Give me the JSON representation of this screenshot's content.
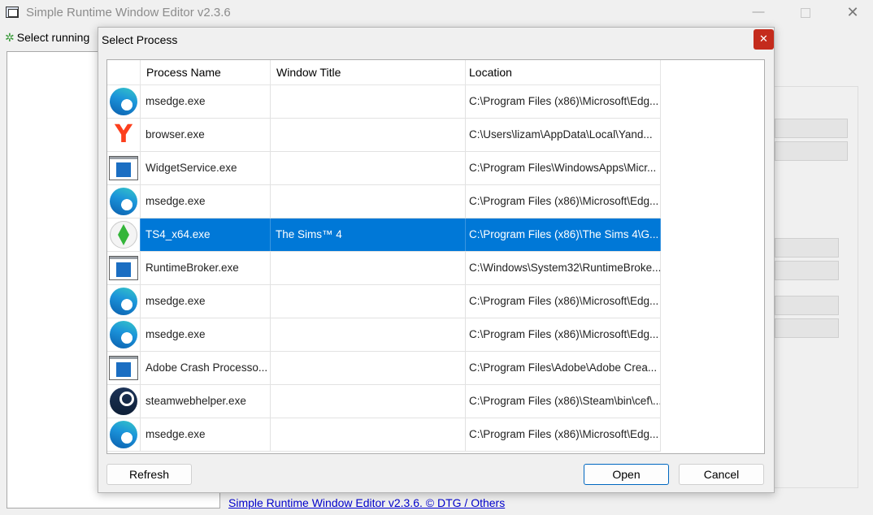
{
  "main_window": {
    "title": "Simple Runtime Window Editor v2.3.6",
    "controls": {
      "minimize": "—",
      "close": "✕"
    },
    "select_running_label": "Select running",
    "footer_link": "Simple Runtime Window Editor v2.3.6.  ©   DTG   / Others"
  },
  "dialog": {
    "title": "Select Process",
    "close_glyph": "✕",
    "columns": [
      "Process Name",
      "Window Title",
      "Location"
    ],
    "rows": [
      {
        "icon": "edge-icon",
        "name": "msedge.exe",
        "window_title": "",
        "location": "C:\\Program Files (x86)\\Microsoft\\Edg..."
      },
      {
        "icon": "yandex-icon",
        "name": "browser.exe",
        "window_title": "",
        "location": "C:\\Users\\lizam\\AppData\\Local\\Yand..."
      },
      {
        "icon": "widget-app-icon",
        "name": "WidgetService.exe",
        "window_title": "",
        "location": "C:\\Program Files\\WindowsApps\\Micr..."
      },
      {
        "icon": "edge-icon",
        "name": "msedge.exe",
        "window_title": "",
        "location": "C:\\Program Files (x86)\\Microsoft\\Edg..."
      },
      {
        "icon": "sims-plumbob-icon",
        "name": "TS4_x64.exe",
        "window_title": "The Sims™ 4",
        "location": "C:\\Program Files (x86)\\The Sims 4\\G...",
        "selected": true
      },
      {
        "icon": "widget-app-icon",
        "name": "RuntimeBroker.exe",
        "window_title": "",
        "location": "C:\\Windows\\System32\\RuntimeBroke..."
      },
      {
        "icon": "edge-icon",
        "name": "msedge.exe",
        "window_title": "",
        "location": "C:\\Program Files (x86)\\Microsoft\\Edg..."
      },
      {
        "icon": "edge-icon",
        "name": "msedge.exe",
        "window_title": "",
        "location": "C:\\Program Files (x86)\\Microsoft\\Edg..."
      },
      {
        "icon": "widget-app-icon",
        "name": "Adobe Crash Processo...",
        "window_title": "",
        "location": "C:\\Program Files\\Adobe\\Adobe Crea..."
      },
      {
        "icon": "steam-icon",
        "name": "steamwebhelper.exe",
        "window_title": "",
        "location": "C:\\Program Files (x86)\\Steam\\bin\\cef\\..."
      },
      {
        "icon": "edge-icon",
        "name": "msedge.exe",
        "window_title": "",
        "location": "C:\\Program Files (x86)\\Microsoft\\Edg..."
      }
    ],
    "buttons": {
      "refresh": "Refresh",
      "open": "Open",
      "cancel": "Cancel"
    }
  },
  "colors": {
    "selection": "#0078d7",
    "close_red": "#c42b1c",
    "link": "#0000cc"
  }
}
